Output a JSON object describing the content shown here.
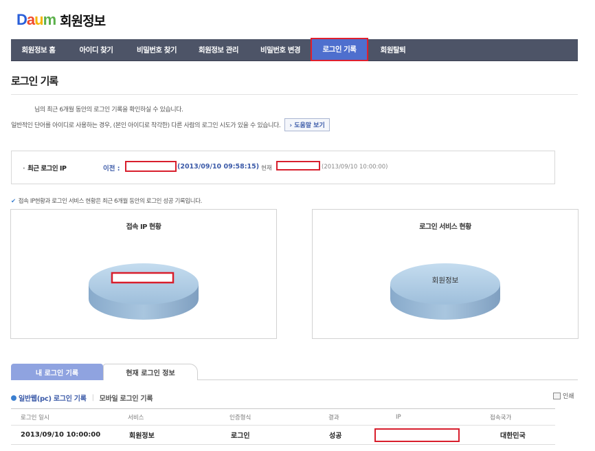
{
  "header": {
    "brand": "Daum",
    "brand_letters": [
      "D",
      "a",
      "u",
      "m"
    ],
    "title": "회원정보"
  },
  "nav": {
    "items": [
      {
        "label": "회원정보 홈"
      },
      {
        "label": "아이디 찾기"
      },
      {
        "label": "비밀번호 찾기"
      },
      {
        "label": "회원정보 관리"
      },
      {
        "label": "비밀번호 변경"
      },
      {
        "label": "로그인 기록"
      },
      {
        "label": "회원탈퇴"
      }
    ],
    "active_label": "로그인 기록"
  },
  "page": {
    "title": "로그인 기록",
    "intro1": "님의 최근 6개월 동안의 로그인 기록을 확인하실 수 있습니다.",
    "intro2": "일반적인 단어를 아이디로 사용하는 경우, (본인 아이디로 착각한) 다른 사람의 로그인 시도가 있을 수 있습니다.",
    "help_button": "도움말 보기",
    "help_button_icon": "chevron-right-icon"
  },
  "recent_ip": {
    "label": "최근 로그인 IP",
    "prev_label": "이전 :",
    "prev_time": "(2013/09/10 09:58:15)",
    "current_label": "현재",
    "current_time": "(2013/09/10 10:00:00)"
  },
  "note": "접속 IP현황과 로그인 서비스 현황은 최근 6개월 동안의 로그인 성공 기록입니다.",
  "charts": {
    "left_title": "접속 IP 현황",
    "right_title": "로그인 서비스 현황",
    "right_slice_label": "회원정보"
  },
  "chart_data": [
    {
      "type": "pie",
      "title": "접속 IP 현황",
      "categories": [
        ""
      ],
      "values": [
        100
      ]
    },
    {
      "type": "pie",
      "title": "로그인 서비스 현황",
      "categories": [
        "회원정보"
      ],
      "values": [
        100
      ]
    }
  ],
  "tabs": {
    "my_login": "내 로그인 기록",
    "current_login": "현재 로그인 정보"
  },
  "subtabs": {
    "pc": "일반웹(pc) 로그인 기록",
    "mobile": "모바일 로그인 기록",
    "print": "인쇄"
  },
  "table": {
    "headers": [
      "로그인 일시",
      "서비스",
      "인증형식",
      "결과",
      "IP",
      "접속국가"
    ],
    "rows": [
      {
        "datetime": "2013/09/10 10:00:00",
        "service": "회원정보",
        "auth": "로그인",
        "result": "성공",
        "ip": "",
        "country": "대한민국"
      }
    ]
  },
  "colors": {
    "nav_bg": "#4d5467",
    "nav_active": "#4e6fce",
    "redaction": "#d81e2c",
    "pie_fill": "#9fbfdb",
    "tab_active": "#8fa3e0"
  }
}
